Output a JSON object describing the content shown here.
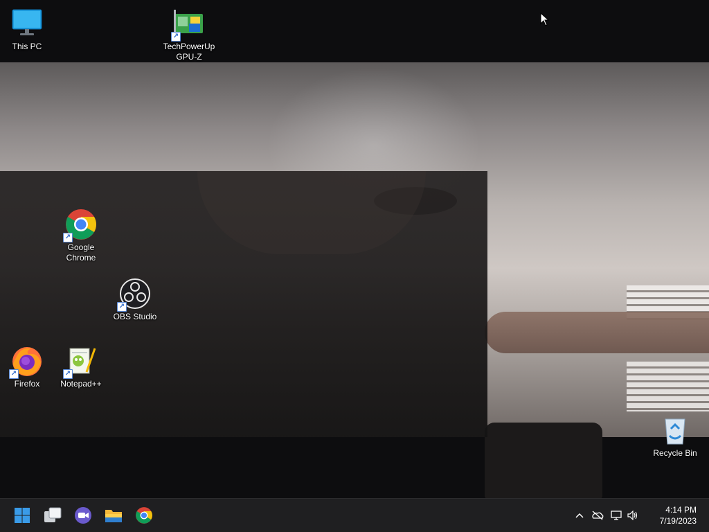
{
  "desktop": {
    "icons": [
      {
        "label": "This PC",
        "icon": "monitor-icon",
        "shortcut": false
      },
      {
        "label": "TechPowerUp GPU-Z",
        "icon": "gpu-card-icon",
        "shortcut": true
      },
      {
        "label": "Google Chrome",
        "icon": "chrome-icon",
        "shortcut": true
      },
      {
        "label": "OBS Studio",
        "icon": "obs-icon",
        "shortcut": true
      },
      {
        "label": "Firefox",
        "icon": "firefox-icon",
        "shortcut": true
      },
      {
        "label": "Notepad++",
        "icon": "notepad-plus-plus-icon",
        "shortcut": true
      },
      {
        "label": "Recycle Bin",
        "icon": "recycle-bin-icon",
        "shortcut": false
      }
    ]
  },
  "taskbar": {
    "pinned": [
      {
        "name": "Start",
        "icon": "windows-start-icon"
      },
      {
        "name": "Task View",
        "icon": "task-view-icon"
      },
      {
        "name": "Chat",
        "icon": "chat-icon"
      },
      {
        "name": "File Explorer",
        "icon": "folder-icon"
      },
      {
        "name": "Google Chrome",
        "icon": "chrome-icon"
      }
    ],
    "tray": {
      "overflow_icon": "chevron-up-icon",
      "icons": [
        "network-offline-icon",
        "display-icon",
        "speaker-icon"
      ]
    },
    "clock": {
      "time": "4:14 PM",
      "date": "7/19/2023"
    }
  },
  "colors": {
    "taskbar_bg": "#1f1f21",
    "start_blue": "#3a9be8",
    "chrome_red": "#db4437",
    "chrome_yellow": "#f4c20d",
    "chrome_green": "#0f9d58",
    "chrome_blue": "#4285f4"
  }
}
